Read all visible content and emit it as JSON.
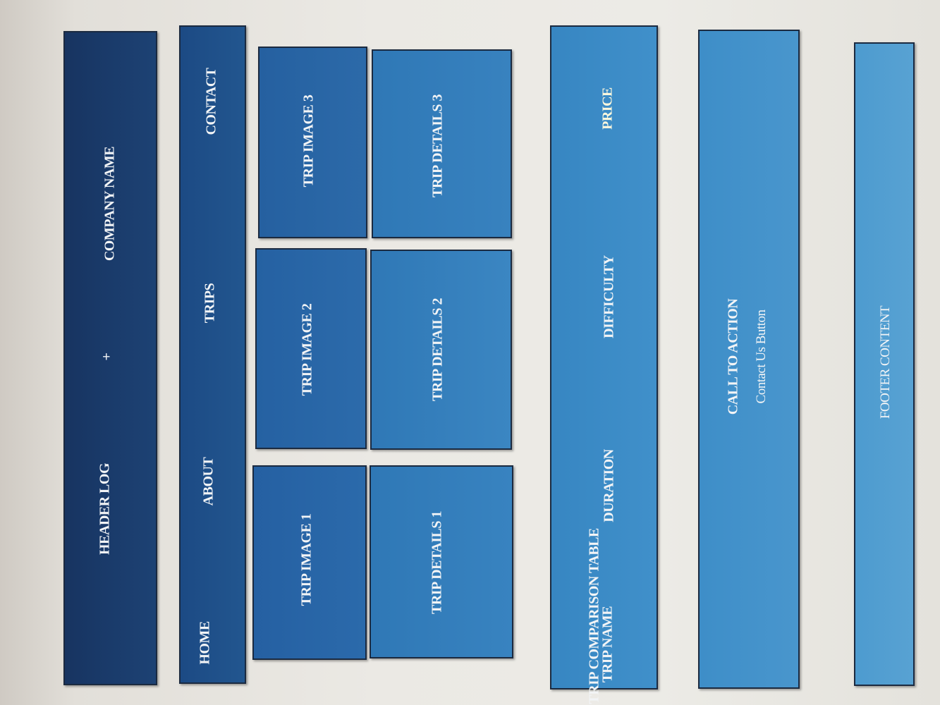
{
  "header": {
    "logo": "HEADER LOG",
    "plus": "+",
    "company": "COMPANY NAME"
  },
  "nav": [
    {
      "label": "HOME"
    },
    {
      "label": "ABOUT"
    },
    {
      "label": "TRIPS"
    },
    {
      "label": "CONTACT"
    }
  ],
  "trips": [
    {
      "image": "TRIP IMAGE 1",
      "details": "TRIP DETAILS 1"
    },
    {
      "image": "TRIP IMAGE 2",
      "details": "TRIP DETAILS 2"
    },
    {
      "image": "TRIP IMAGE 3",
      "details": "TRIP DETAILS 3"
    }
  ],
  "comparison": {
    "title": "TRIP COMPARISON TABLE",
    "columns": [
      "TRIP NAME",
      "DURATION",
      "DIFFICULTY",
      "PRICE"
    ]
  },
  "cta": {
    "title": "CALL TO ACTION",
    "button": "Contact Us Button"
  },
  "footer": {
    "text": "FOOTER CONTENT"
  },
  "colors": {
    "header": "#1a3a6b",
    "nav": "#1f4f89",
    "trip_image": "#2a6aa8",
    "trip_details": "#3580bd",
    "comparison": "#3d8fc8",
    "cta": "#4796cc",
    "footer": "#5aa3d2"
  }
}
